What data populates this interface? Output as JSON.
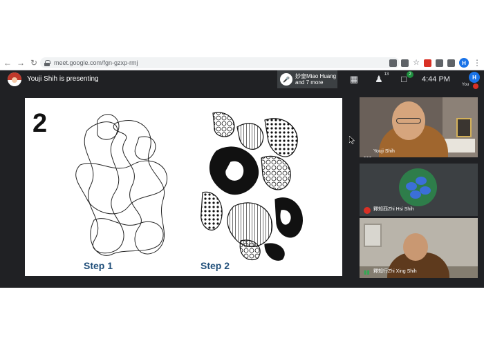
{
  "browser": {
    "back_icon": "arrow-left-icon",
    "forward_icon": "arrow-right-icon",
    "reload_icon": "reload-icon",
    "url": "meet.google.com/fgn-gzxp-rmj",
    "profile_initial": "H"
  },
  "meet": {
    "presenting_text": "Youji Shih is presenting",
    "people_chip_line1": "妙皇Miao Huang",
    "people_chip_line2": "and 7 more",
    "people_count": "13",
    "chat_badge": "2",
    "time": "4:44 PM",
    "you_initial": "H",
    "you_label": "You"
  },
  "slide": {
    "number": "2",
    "step1": "Step 1",
    "step2": "Step 2"
  },
  "tiles": [
    {
      "name": "Youji Shih"
    },
    {
      "name": "釋知西Zhi Hsi Shih"
    },
    {
      "name": "釋知行Zhi Xing Shih"
    }
  ],
  "colors": {
    "meet_bg": "#202124",
    "step_label": "#1f4e79",
    "mic_off": "#d93025",
    "badge_green": "#1e8e3e",
    "profile_blue": "#1a73e8"
  }
}
